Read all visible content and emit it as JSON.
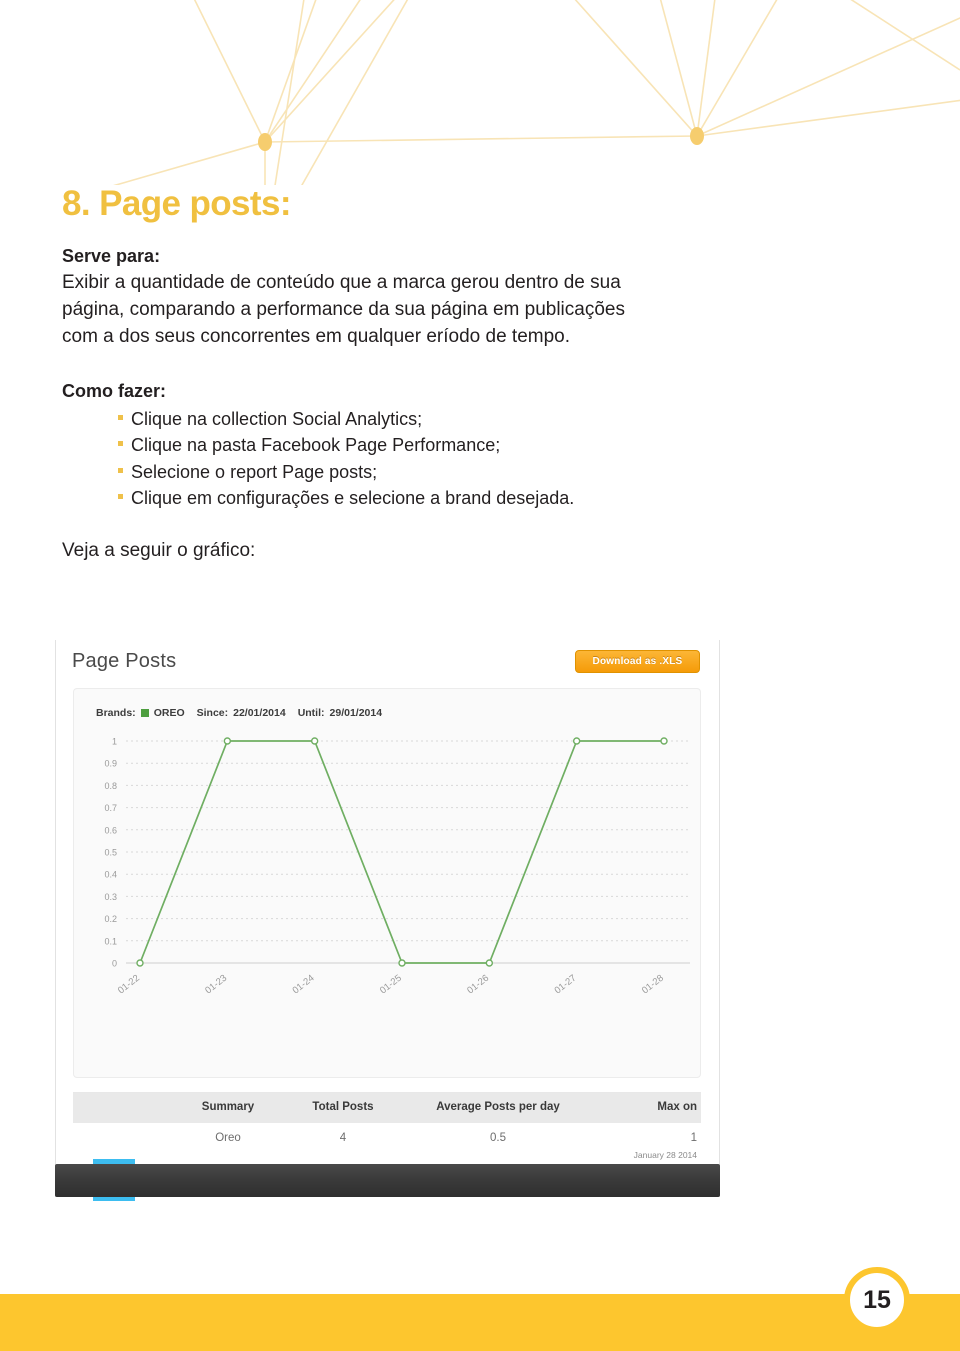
{
  "document": {
    "chapter_title": "8. Page posts:",
    "purpose_label": "Serve para:",
    "purpose_text": "Exibir a quantidade de conteúdo que a marca gerou dentro de sua página, comparando a performance da sua página em publicações com a dos seus concorrentes em qualquer eríodo de tempo.",
    "howto_label": "Como fazer:",
    "howto_steps": [
      "Clique na collection Social Analytics;",
      "Clique na pasta Facebook Page Performance;",
      "Selecione o report Page posts;",
      "Clique em configurações e selecione a brand desejada."
    ],
    "see_next": "Veja a seguir o gráfico:",
    "page_number": "15"
  },
  "screenshot": {
    "title": "Page Posts",
    "download_button": "Download as .XLS",
    "filters": {
      "brands_label": "Brands:",
      "brand_name": "OREO",
      "brand_color": "#4d9e3f",
      "since_label": "Since:",
      "since_value": "22/01/2014",
      "until_label": "Until:",
      "until_value": "29/01/2014"
    },
    "summary": {
      "headers": [
        "Summary",
        "Total Posts",
        "Average Posts per day",
        "Max on"
      ],
      "row": {
        "avatar_name": "oreo-cookie-icon",
        "avatar_background": "#3dbdf0",
        "brand": "Oreo",
        "total_posts": "4",
        "average_posts_per_day": "0.5",
        "max_value": "1",
        "max_date": "January 28 2014"
      }
    }
  },
  "chart_data": {
    "type": "line",
    "title": "Page Posts",
    "categories": [
      "01-22",
      "01-23",
      "01-24",
      "01-25",
      "01-26",
      "01-27",
      "01-28"
    ],
    "series": [
      {
        "name": "OREO",
        "color": "#6fae62",
        "values": [
          0,
          1,
          1,
          0,
          0,
          1,
          1
        ]
      }
    ],
    "xlabel": "",
    "ylabel": "",
    "ylim": [
      0,
      1
    ],
    "yticks": [
      "0",
      "0.1",
      "0.2",
      "0.3",
      "0.4",
      "0.5",
      "0.6",
      "0.7",
      "0.8",
      "0.9",
      "1"
    ],
    "grid": true,
    "legend": "none"
  },
  "theme": {
    "accent_yellow": "#F0C040",
    "footer_yellow": "#FDC62E",
    "text_dark": "#231f20",
    "network_line": "#f7e3b4"
  }
}
